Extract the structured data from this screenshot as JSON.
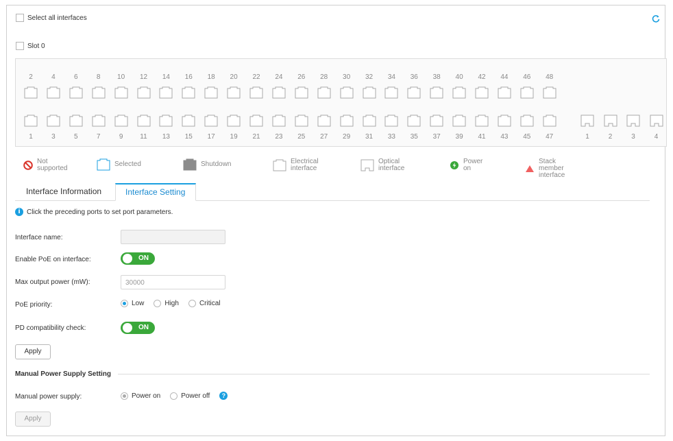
{
  "select_all_label": "Select all interfaces",
  "slot_label": "Slot 0",
  "ports": {
    "even": [
      "2",
      "4",
      "6",
      "8",
      "10",
      "12",
      "14",
      "16",
      "18",
      "20",
      "22",
      "24",
      "26",
      "28",
      "30",
      "32",
      "34",
      "36",
      "38",
      "40",
      "42",
      "44",
      "46",
      "48"
    ],
    "odd": [
      "1",
      "3",
      "5",
      "7",
      "9",
      "11",
      "13",
      "15",
      "17",
      "19",
      "21",
      "23",
      "25",
      "27",
      "29",
      "31",
      "33",
      "35",
      "37",
      "39",
      "41",
      "43",
      "45",
      "47"
    ],
    "optical": [
      "1",
      "2",
      "3",
      "4"
    ]
  },
  "legend": {
    "not_supported": "Not supported",
    "selected": "Selected",
    "shutdown": "Shutdown",
    "electrical": "Electrical interface",
    "optical": "Optical interface",
    "power_on": "Power on",
    "stack_member": "Stack member interface"
  },
  "tabs": [
    "Interface Information",
    "Interface Setting"
  ],
  "active_tab": "Interface Setting",
  "hint": "Click the preceding ports to set port parameters.",
  "form": {
    "interface_name_label": "Interface name:",
    "interface_name_value": "",
    "enable_poe_label": "Enable PoE on interface:",
    "enable_poe_state": "ON",
    "max_power_label": "Max output power (mW):",
    "max_power_placeholder": "30000",
    "poe_priority_label": "PoE priority:",
    "poe_priority_options": [
      "Low",
      "High",
      "Critical"
    ],
    "poe_priority_selected": "Low",
    "pd_check_label": "PD compatibility check:",
    "pd_check_state": "ON",
    "apply_label": "Apply"
  },
  "manual": {
    "section_title": "Manual Power Supply Setting",
    "label": "Manual power supply:",
    "options": [
      "Power on",
      "Power off"
    ],
    "selected": "Power on",
    "apply_label": "Apply"
  },
  "colors": {
    "accent": "#1a9fe0",
    "toggle_on": "#3aa83a",
    "error": "#d9342b",
    "stack": "#f06060"
  }
}
